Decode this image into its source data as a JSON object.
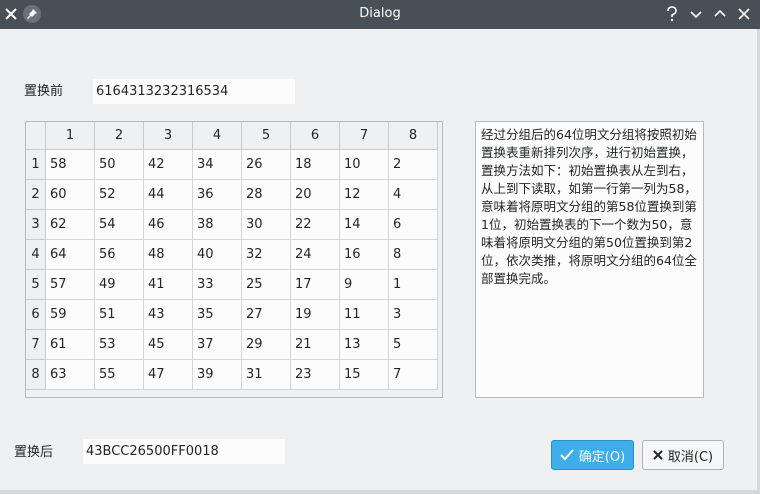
{
  "window": {
    "title": "Dialog",
    "buttons": [
      "close-icon",
      "pin-icon",
      "help-icon",
      "minimize-icon",
      "maximize-icon",
      "close-icon"
    ]
  },
  "before": {
    "label": "置换前",
    "value": "6164313232316534"
  },
  "after": {
    "label": "置换后",
    "value": "43BCC26500FF0018"
  },
  "table": {
    "columns": [
      "1",
      "2",
      "3",
      "4",
      "5",
      "6",
      "7",
      "8"
    ],
    "rows": [
      {
        "header": "1",
        "cells": [
          "58",
          "50",
          "42",
          "34",
          "26",
          "18",
          "10",
          "2"
        ]
      },
      {
        "header": "2",
        "cells": [
          "60",
          "52",
          "44",
          "36",
          "28",
          "20",
          "12",
          "4"
        ]
      },
      {
        "header": "3",
        "cells": [
          "62",
          "54",
          "46",
          "38",
          "30",
          "22",
          "14",
          "6"
        ]
      },
      {
        "header": "4",
        "cells": [
          "64",
          "56",
          "48",
          "40",
          "32",
          "24",
          "16",
          "8"
        ]
      },
      {
        "header": "5",
        "cells": [
          "57",
          "49",
          "41",
          "33",
          "25",
          "17",
          "9",
          "1"
        ]
      },
      {
        "header": "6",
        "cells": [
          "59",
          "51",
          "43",
          "35",
          "27",
          "19",
          "11",
          "3"
        ]
      },
      {
        "header": "7",
        "cells": [
          "61",
          "53",
          "45",
          "37",
          "29",
          "21",
          "13",
          "5"
        ]
      },
      {
        "header": "8",
        "cells": [
          "63",
          "55",
          "47",
          "39",
          "31",
          "23",
          "15",
          "7"
        ]
      }
    ]
  },
  "description": "经过分组后的64位明文分组将按照初始置换表重新排列次序，进行初始置换，置换方法如下：初始置换表从左到右，从上到下读取，如第一行第一列为58，意味着将原明文分组的第58位置换到第1位，初始置换表的下一个数为50，意味着将原明文分组的第50位置换到第2位，依次类推，将原明文分组的64位全部置换完成。",
  "buttons": {
    "ok_label": "确定(O)",
    "cancel_label": "取消(C)",
    "ok_icon": "check-icon",
    "cancel_icon": "x-icon"
  },
  "colors": {
    "titlebar": "#475057",
    "accent": "#3daee9",
    "background": "#eff0f1"
  }
}
